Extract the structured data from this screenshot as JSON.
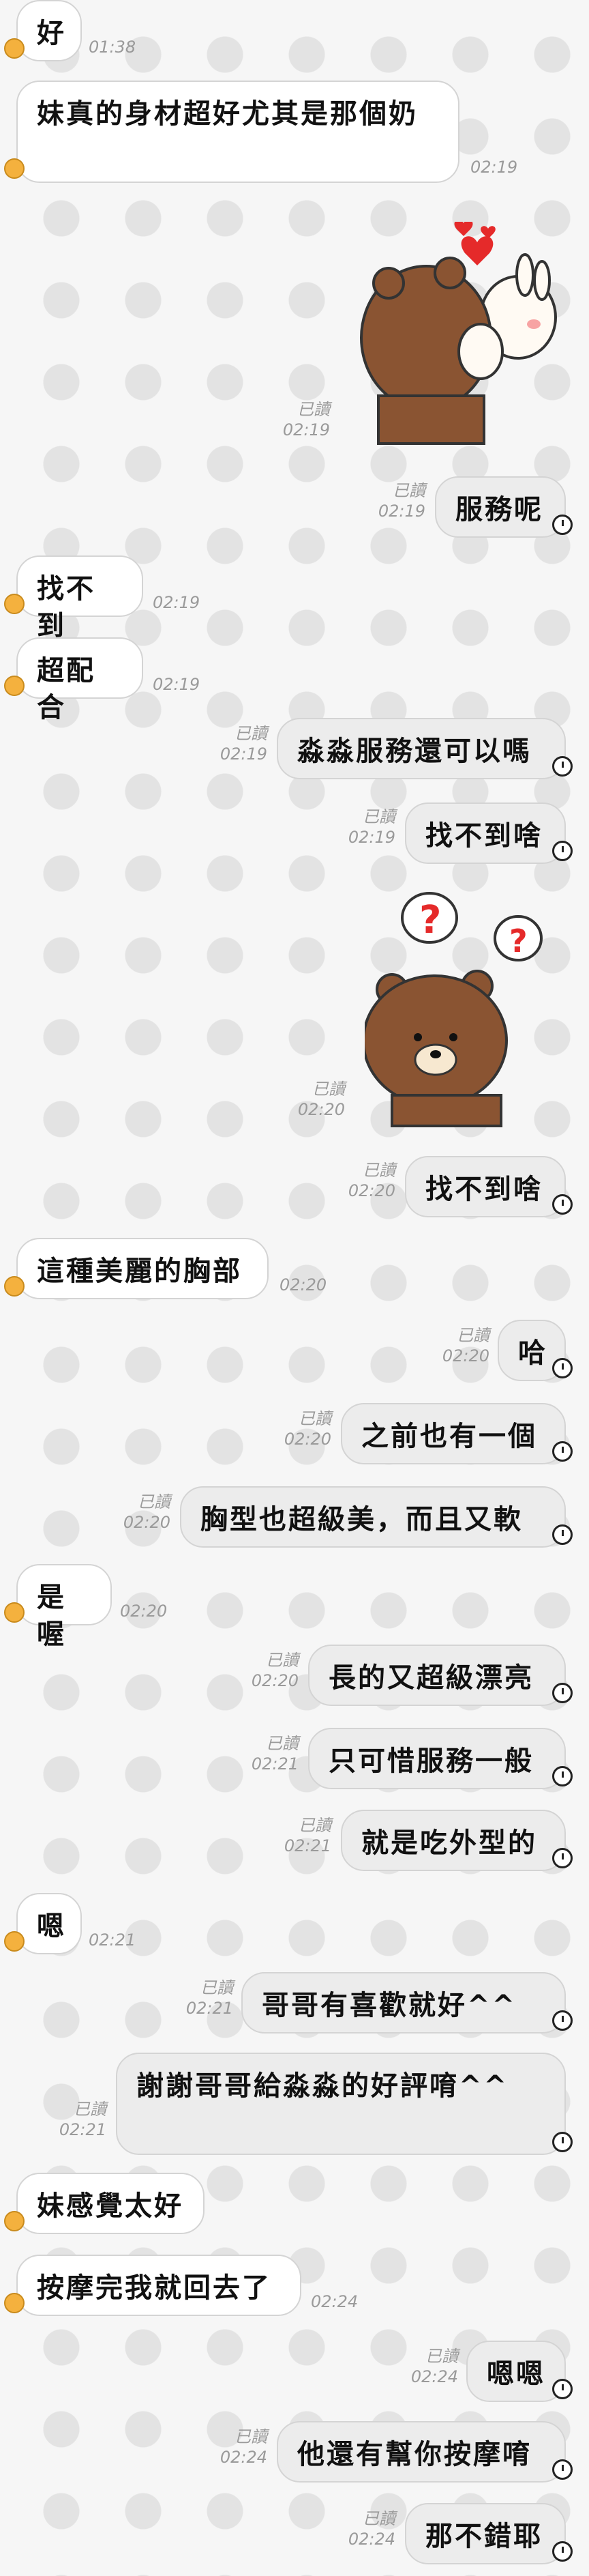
{
  "messages": [
    {
      "dir": "in",
      "text": "好",
      "time": "01:38",
      "read": ""
    },
    {
      "dir": "in",
      "text": "妹真的身材超好尤其是那個奶",
      "time": "02:19",
      "read": ""
    },
    {
      "dir": "out",
      "sticker": "bear-hug-sticker",
      "time": "02:19",
      "read": "已讀"
    },
    {
      "dir": "out",
      "text": "服務呢",
      "time": "02:19",
      "read": "已讀"
    },
    {
      "dir": "in",
      "text": "找不到",
      "time": "02:19",
      "read": ""
    },
    {
      "dir": "in",
      "text": "超配合",
      "time": "02:19",
      "read": ""
    },
    {
      "dir": "out",
      "text": "淼淼服務還可以嗎",
      "time": "02:19",
      "read": "已讀"
    },
    {
      "dir": "out",
      "text": "找不到啥",
      "time": "02:19",
      "read": "已讀"
    },
    {
      "dir": "out",
      "sticker": "bear-question-sticker",
      "time": "02:20",
      "read": "已讀"
    },
    {
      "dir": "out",
      "text": "找不到啥",
      "time": "02:20",
      "read": "已讀"
    },
    {
      "dir": "in",
      "text": "這種美麗的胸部",
      "time": "02:20",
      "read": ""
    },
    {
      "dir": "out",
      "text": "哈",
      "time": "02:20",
      "read": "已讀"
    },
    {
      "dir": "out",
      "text": "之前也有一個",
      "time": "02:20",
      "read": "已讀"
    },
    {
      "dir": "out",
      "text": "胸型也超級美，而且又軟",
      "time": "02:20",
      "read": "已讀"
    },
    {
      "dir": "in",
      "text": "是喔",
      "time": "02:20",
      "read": ""
    },
    {
      "dir": "out",
      "text": "長的又超級漂亮",
      "time": "02:20",
      "read": "已讀"
    },
    {
      "dir": "out",
      "text": "只可惜服務一般",
      "time": "02:21",
      "read": "已讀"
    },
    {
      "dir": "out",
      "text": "就是吃外型的",
      "time": "02:21",
      "read": "已讀"
    },
    {
      "dir": "in",
      "text": "嗯",
      "time": "02:21",
      "read": ""
    },
    {
      "dir": "out",
      "text": "哥哥有喜歡就好^^",
      "time": "02:21",
      "read": "已讀"
    },
    {
      "dir": "out",
      "text": "謝謝哥哥給淼淼的好評唷^^",
      "time": "02:21",
      "read": "已讀"
    },
    {
      "dir": "in",
      "text": "妹感覺太好",
      "time": "",
      "read": ""
    },
    {
      "dir": "in",
      "text": "按摩完我就回去了",
      "time": "02:24",
      "read": ""
    },
    {
      "dir": "out",
      "text": "嗯嗯",
      "time": "02:24",
      "read": "已讀"
    },
    {
      "dir": "out",
      "text": "他還有幫你按摩唷",
      "time": "02:24",
      "read": "已讀"
    },
    {
      "dir": "out",
      "text": "那不錯耶",
      "time": "02:24",
      "read": "已讀"
    }
  ]
}
